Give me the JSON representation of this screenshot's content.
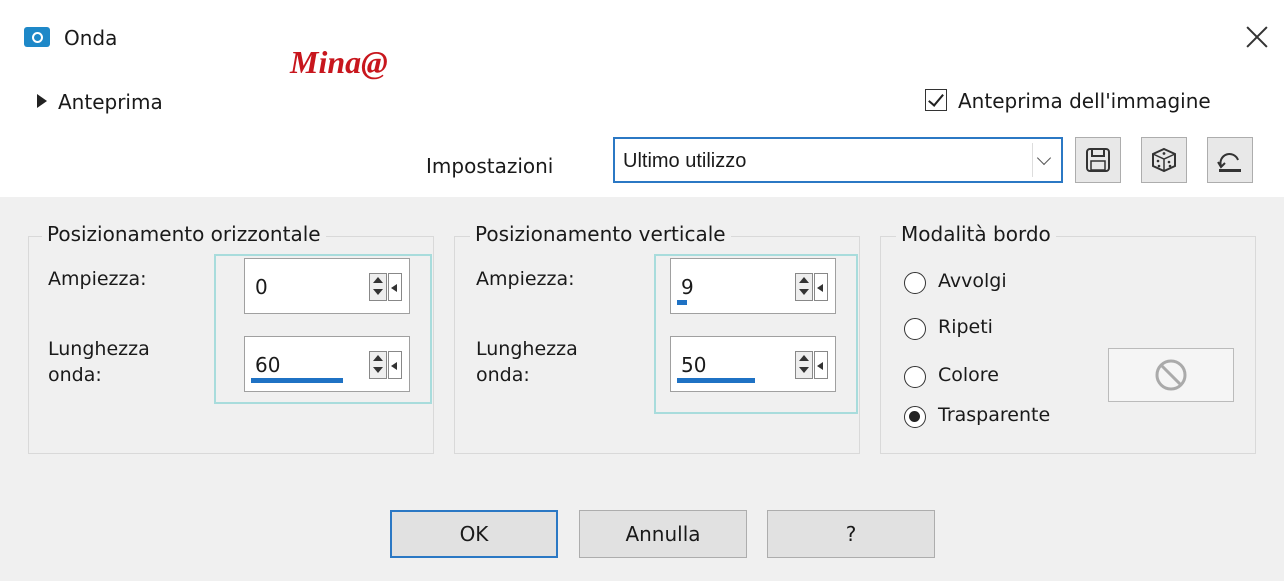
{
  "window": {
    "title": "Onda",
    "watermark": "Mina@"
  },
  "preview": {
    "toggle_label": "Anteprima",
    "image_preview_label": "Anteprima dell'immagine",
    "image_preview_checked": true
  },
  "settings": {
    "label": "Impostazioni",
    "selected": "Ultimo utilizzo"
  },
  "horizontal": {
    "legend": "Posizionamento orizzontale",
    "amplitude_label": "Ampiezza:",
    "amplitude_value": "0",
    "wavelength_label_1": "Lunghezza",
    "wavelength_label_2": "onda:",
    "wavelength_value": "60"
  },
  "vertical": {
    "legend": "Posizionamento verticale",
    "amplitude_label": "Ampiezza:",
    "amplitude_value": "9",
    "wavelength_label_1": "Lunghezza",
    "wavelength_label_2": "onda:",
    "wavelength_value": "50"
  },
  "edge_mode": {
    "legend": "Modalità bordo",
    "options": [
      "Avvolgi",
      "Ripeti",
      "Colore",
      "Trasparente"
    ],
    "selected": "Trasparente"
  },
  "buttons": {
    "ok": "OK",
    "cancel": "Annulla",
    "help": "?"
  },
  "colors": {
    "accent": "#2b78c4",
    "logo": "#c8161d",
    "slider": "#1f72c4"
  }
}
